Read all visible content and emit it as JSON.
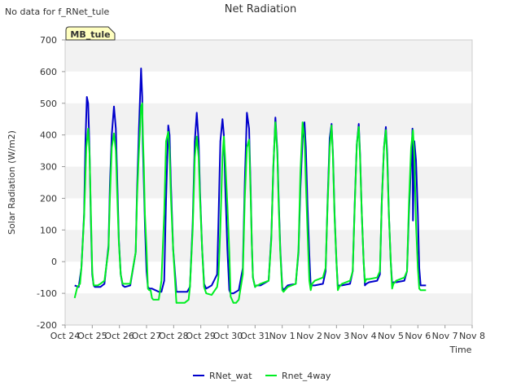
{
  "notice": "No data for f_RNet_tule",
  "site_badge": "MB_tule",
  "chart_data": {
    "type": "line",
    "title": "Net Radiation",
    "xlabel": "Time",
    "ylabel": "Solar Radiation (W/m2)",
    "ylim": [
      -200,
      700
    ],
    "yticks": [
      -200,
      -100,
      0,
      100,
      200,
      300,
      400,
      500,
      600,
      700
    ],
    "xlim": [
      0,
      15
    ],
    "xticks": [
      0,
      1,
      2,
      3,
      4,
      5,
      6,
      7,
      8,
      9,
      10,
      11,
      12,
      13,
      14,
      15
    ],
    "xtick_labels": [
      "Oct 24",
      "Oct 25",
      "Oct 26",
      "Oct 27",
      "Oct 28",
      "Oct 29",
      "Oct 30",
      "Oct 31",
      "Nov 1",
      "Nov 2",
      "Nov 3",
      "Nov 4",
      "Nov 5",
      "Nov 6",
      "Nov 7",
      "Nov 8"
    ],
    "x_unit": "days from Oct 24",
    "grid": "horizontal bands",
    "legend_position": "bottom",
    "series": [
      {
        "name": "RNet_wat",
        "color": "#0000cc",
        "x": [
          0.35,
          0.5,
          0.6,
          0.7,
          0.75,
          0.8,
          0.85,
          0.9,
          0.95,
          1.0,
          1.05,
          1.1,
          1.2,
          1.3,
          1.45,
          1.6,
          1.65,
          1.72,
          1.8,
          1.87,
          1.92,
          1.98,
          2.05,
          2.12,
          2.2,
          2.4,
          2.6,
          2.65,
          2.72,
          2.8,
          2.84,
          2.86,
          2.9,
          2.94,
          3.0,
          3.05,
          3.1,
          3.2,
          3.45,
          3.55,
          3.65,
          3.72,
          3.8,
          3.85,
          3.9,
          3.98,
          4.1,
          4.5,
          4.6,
          4.7,
          4.78,
          4.85,
          4.92,
          4.97,
          5.05,
          5.12,
          5.2,
          5.4,
          5.6,
          5.65,
          5.72,
          5.8,
          5.85,
          5.9,
          5.98,
          6.05,
          6.1,
          6.2,
          6.4,
          6.55,
          6.62,
          6.7,
          6.78,
          6.84,
          6.88,
          6.92,
          7.0,
          7.05,
          7.1,
          7.2,
          7.5,
          7.6,
          7.67,
          7.75,
          7.82,
          7.87,
          7.93,
          8.0,
          8.05,
          8.1,
          8.2,
          8.5,
          8.6,
          8.67,
          8.75,
          8.82,
          8.87,
          8.93,
          9.0,
          9.05,
          9.1,
          9.2,
          9.5,
          9.6,
          9.67,
          9.75,
          9.82,
          9.87,
          9.93,
          10.0,
          10.05,
          10.1,
          10.2,
          10.5,
          10.6,
          10.67,
          10.75,
          10.82,
          10.87,
          10.93,
          11.0,
          11.05,
          11.1,
          11.2,
          11.5,
          11.6,
          11.67,
          11.75,
          11.82,
          11.87,
          11.93,
          12.0,
          12.05,
          12.1,
          12.2,
          12.5,
          12.6,
          12.67,
          12.75,
          12.8,
          12.82,
          12.87,
          12.93,
          13.0,
          13.05,
          13.1,
          13.2,
          13.3
        ],
        "y": [
          -75,
          -80,
          -20,
          150,
          380,
          520,
          500,
          350,
          120,
          -40,
          -75,
          -80,
          -80,
          -80,
          -70,
          50,
          240,
          400,
          490,
          420,
          260,
          70,
          -40,
          -75,
          -80,
          -75,
          30,
          220,
          420,
          610,
          520,
          380,
          250,
          120,
          -30,
          -80,
          -85,
          -85,
          -95,
          -95,
          -60,
          200,
          430,
          400,
          240,
          40,
          -95,
          -95,
          -80,
          120,
          380,
          470,
          380,
          220,
          40,
          -70,
          -85,
          -75,
          -40,
          120,
          380,
          450,
          400,
          240,
          40,
          -90,
          -100,
          -100,
          -90,
          -20,
          250,
          470,
          420,
          220,
          60,
          -50,
          -80,
          -75,
          -75,
          -75,
          -60,
          80,
          290,
          455,
          350,
          200,
          40,
          -80,
          -90,
          -85,
          -75,
          -70,
          30,
          230,
          390,
          440,
          360,
          180,
          20,
          -80,
          -75,
          -75,
          -70,
          -30,
          180,
          390,
          435,
          340,
          150,
          0,
          -80,
          -75,
          -75,
          -70,
          -30,
          180,
          370,
          435,
          340,
          160,
          0,
          -75,
          -70,
          -65,
          -60,
          -40,
          190,
          360,
          425,
          340,
          150,
          0,
          -70,
          -65,
          -65,
          -60,
          -30,
          150,
          310,
          420,
          130,
          380,
          320,
          150,
          -20,
          -75,
          -75,
          -75
        ]
      },
      {
        "name": "Rnet_4way",
        "color": "#00ee22",
        "x": [
          0.35,
          0.45,
          0.55,
          0.6,
          0.7,
          0.78,
          0.85,
          0.9,
          0.95,
          1.0,
          1.05,
          1.1,
          1.2,
          1.3,
          1.45,
          1.6,
          1.65,
          1.72,
          1.8,
          1.87,
          1.92,
          1.98,
          2.05,
          2.12,
          2.2,
          2.4,
          2.6,
          2.65,
          2.72,
          2.8,
          2.84,
          2.86,
          2.9,
          2.94,
          3.0,
          3.05,
          3.1,
          3.15,
          3.2,
          3.25,
          3.45,
          3.55,
          3.65,
          3.72,
          3.8,
          3.85,
          3.9,
          3.98,
          4.1,
          4.4,
          4.55,
          4.6,
          4.7,
          4.78,
          4.85,
          4.92,
          4.97,
          5.05,
          5.12,
          5.2,
          5.4,
          5.6,
          5.65,
          5.72,
          5.8,
          5.85,
          5.9,
          5.98,
          6.05,
          6.1,
          6.2,
          6.3,
          6.4,
          6.55,
          6.62,
          6.7,
          6.78,
          6.84,
          6.88,
          6.92,
          7.0,
          7.05,
          7.1,
          7.2,
          7.5,
          7.6,
          7.67,
          7.75,
          7.82,
          7.87,
          7.93,
          8.0,
          8.05,
          8.1,
          8.2,
          8.5,
          8.6,
          8.67,
          8.75,
          8.82,
          8.87,
          8.93,
          9.0,
          9.05,
          9.1,
          9.2,
          9.5,
          9.6,
          9.67,
          9.75,
          9.82,
          9.87,
          9.93,
          10.0,
          10.05,
          10.1,
          10.2,
          10.5,
          10.6,
          10.67,
          10.75,
          10.82,
          10.87,
          10.93,
          11.0,
          11.05,
          11.1,
          11.2,
          11.5,
          11.6,
          11.67,
          11.75,
          11.82,
          11.87,
          11.93,
          12.0,
          12.05,
          12.1,
          12.2,
          12.5,
          12.6,
          12.67,
          12.75,
          12.82,
          12.87,
          12.93,
          13.0,
          13.05,
          13.1,
          13.2,
          13.3
        ],
        "y": [
          -115,
          -80,
          -70,
          -20,
          140,
          360,
          420,
          340,
          150,
          -30,
          -75,
          -75,
          -75,
          -70,
          -60,
          40,
          200,
          360,
          405,
          350,
          210,
          60,
          -40,
          -70,
          -70,
          -70,
          30,
          200,
          350,
          490,
          500,
          420,
          300,
          150,
          40,
          -85,
          -90,
          -90,
          -115,
          -120,
          -120,
          -60,
          150,
          380,
          410,
          350,
          200,
          40,
          -130,
          -130,
          -120,
          -80,
          100,
          330,
          395,
          330,
          200,
          40,
          -80,
          -100,
          -105,
          -80,
          -50,
          110,
          330,
          395,
          320,
          180,
          30,
          -110,
          -130,
          -130,
          -120,
          -40,
          200,
          360,
          385,
          200,
          60,
          -50,
          -80,
          -75,
          -75,
          -70,
          -60,
          70,
          300,
          440,
          340,
          180,
          30,
          -90,
          -95,
          -90,
          -80,
          -70,
          40,
          280,
          440,
          390,
          250,
          100,
          -60,
          -90,
          -70,
          -60,
          -50,
          -20,
          170,
          360,
          430,
          330,
          140,
          0,
          -90,
          -80,
          -70,
          -60,
          -30,
          170,
          370,
          425,
          330,
          160,
          0,
          -65,
          -55,
          -55,
          -50,
          -30,
          190,
          360,
          415,
          320,
          150,
          0,
          -85,
          -70,
          -60,
          -50,
          -30,
          180,
          360,
          415,
          330,
          120,
          -20,
          -85,
          -90,
          -90,
          -90
        ]
      }
    ]
  }
}
